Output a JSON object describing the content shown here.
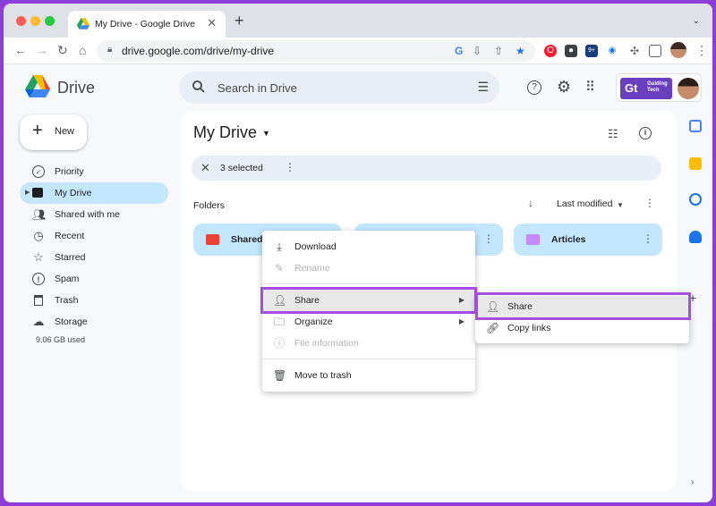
{
  "browser": {
    "tab_title": "My Drive - Google Drive",
    "tab_close": "✕",
    "new_tab": "+",
    "tab_menu": "⌄",
    "url": "drive.google.com/drive/my-drive",
    "ext_badge": "9+"
  },
  "drive": {
    "brand": "Drive",
    "search_placeholder": "Search in Drive",
    "gt_mark": "Gt",
    "gt_name": "Guiding Tech"
  },
  "sidebar": {
    "new_label": "New",
    "items": [
      {
        "label": "Priority",
        "icon": "priority-icon"
      },
      {
        "label": "My Drive",
        "icon": "my-drive-icon"
      },
      {
        "label": "Shared with me",
        "icon": "shared-with-me-icon"
      },
      {
        "label": "Recent",
        "icon": "clock-icon"
      },
      {
        "label": "Starred",
        "icon": "star-icon"
      },
      {
        "label": "Spam",
        "icon": "spam-icon"
      },
      {
        "label": "Trash",
        "icon": "trash-icon"
      },
      {
        "label": "Storage",
        "icon": "cloud-icon"
      }
    ],
    "storage_used": "9.06 GB used"
  },
  "main": {
    "title": "My Drive",
    "selection_count": "3 selected",
    "folders_label": "Folders",
    "sort_label": "Last modified",
    "folders": [
      {
        "name": "Shared",
        "color": "#ea4335"
      },
      {
        "name": "",
        "color": "#5f6368"
      },
      {
        "name": "Articles",
        "color": "#c58af9"
      }
    ]
  },
  "context_menu": {
    "items": [
      {
        "label": "Download",
        "enabled": true,
        "icon": "download-icon"
      },
      {
        "label": "Rename",
        "enabled": false,
        "icon": "edit-icon"
      },
      {
        "label": "Share",
        "enabled": true,
        "icon": "person-add-icon",
        "submenu": true,
        "highlighted": true
      },
      {
        "label": "Organize",
        "enabled": true,
        "icon": "folder-icon",
        "submenu": true
      },
      {
        "label": "File information",
        "enabled": false,
        "icon": "info-icon"
      },
      {
        "label": "Move to trash",
        "enabled": true,
        "icon": "trash-icon"
      }
    ]
  },
  "share_submenu": {
    "items": [
      {
        "label": "Share",
        "icon": "person-add-icon",
        "highlighted": true
      },
      {
        "label": "Copy links",
        "icon": "link-icon"
      }
    ]
  },
  "colors": {
    "highlight_outline": "#a44fe0",
    "active_nav": "#c2e7ff",
    "accent_frame": "#8b3fd6"
  }
}
